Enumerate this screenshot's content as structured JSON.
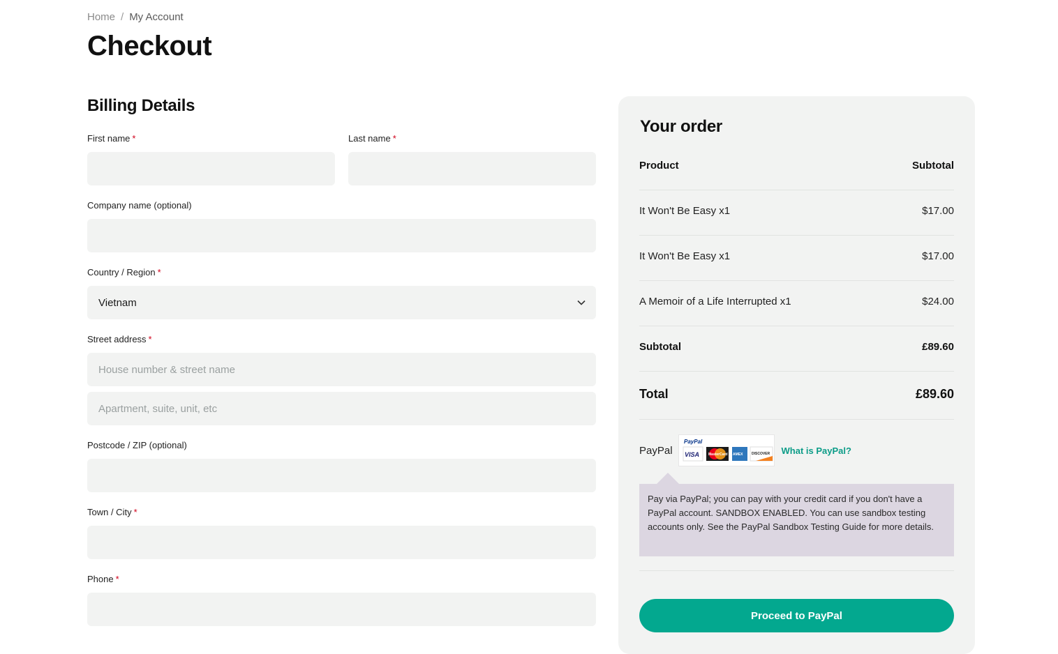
{
  "breadcrumb": {
    "home": "Home",
    "separator": "/",
    "current": "My Account"
  },
  "page": {
    "title": "Checkout"
  },
  "billing": {
    "heading": "Billing Details",
    "required_mark": "*",
    "first_name": {
      "label": "First name",
      "value": ""
    },
    "last_name": {
      "label": "Last name",
      "value": ""
    },
    "company": {
      "label": "Company name (optional)",
      "value": ""
    },
    "country": {
      "label": "Country / Region",
      "value": "Vietnam"
    },
    "street": {
      "label": "Street address",
      "placeholder1": "House number & street name",
      "placeholder2": "Apartment, suite, unit, etc"
    },
    "postcode": {
      "label": "Postcode / ZIP (optional)",
      "value": ""
    },
    "city": {
      "label": "Town / City",
      "value": ""
    },
    "phone": {
      "label": "Phone",
      "value": ""
    }
  },
  "order": {
    "heading": "Your order",
    "col_product": "Product",
    "col_subtotal": "Subtotal",
    "items": [
      {
        "name": "It Won't Be Easy x1",
        "price": "$17.00"
      },
      {
        "name": "It Won't Be Easy x1",
        "price": "$17.00"
      },
      {
        "name": "A Memoir of a Life Interrupted x1",
        "price": "$24.00"
      }
    ],
    "subtotal_label": "Subtotal",
    "subtotal_value": "£89.60",
    "total_label": "Total",
    "total_value": "£89.60"
  },
  "payment": {
    "method_label": "PayPal",
    "logo_text": "PayPal",
    "cards": [
      "VISA",
      "MasterCard",
      "AMEX",
      "DISCOVER"
    ],
    "what_is_link": "What is PayPal?",
    "description": "Pay via PayPal; you can pay with your credit card if you don't have a PayPal account. SANDBOX ENABLED. You can use sandbox testing accounts only. See the PayPal Sandbox Testing Guide for more details.",
    "proceed_label": "Proceed to PayPal"
  },
  "colors": {
    "accent": "#03a88f",
    "link": "#0c9c88",
    "field_bg": "#f2f3f2",
    "notice_bg": "#dcd6e1",
    "required": "#d0021b"
  }
}
